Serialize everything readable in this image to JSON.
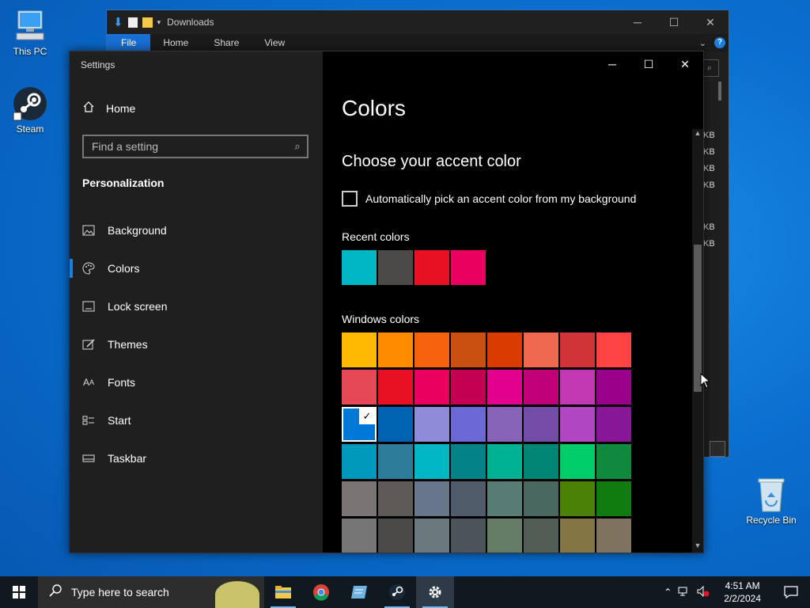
{
  "desktop": {
    "icons": [
      {
        "label": "This PC"
      },
      {
        "label": "Steam"
      },
      {
        "label": "Recycle Bin"
      }
    ]
  },
  "explorer": {
    "title": "Downloads",
    "ribbon_tabs": [
      "File",
      "Home",
      "Share",
      "View"
    ],
    "help": "?",
    "sizes": [
      "KB",
      "KB",
      "KB",
      "KB",
      "KB",
      "KB"
    ]
  },
  "settings": {
    "window_title": "Settings",
    "home_label": "Home",
    "search_placeholder": "Find a setting",
    "section": "Personalization",
    "nav": [
      {
        "label": "Background",
        "icon": "picture-icon"
      },
      {
        "label": "Colors",
        "icon": "palette-icon",
        "active": true
      },
      {
        "label": "Lock screen",
        "icon": "lock-screen-icon"
      },
      {
        "label": "Themes",
        "icon": "brush-icon"
      },
      {
        "label": "Fonts",
        "icon": "font-icon"
      },
      {
        "label": "Start",
        "icon": "start-icon"
      },
      {
        "label": "Taskbar",
        "icon": "taskbar-icon"
      }
    ],
    "page_title": "Colors",
    "accent_heading": "Choose your accent color",
    "auto_pick_label": "Automatically pick an accent color from my background",
    "auto_pick_checked": false,
    "recent_label": "Recent colors",
    "recent_colors": [
      "#00b7c3",
      "#4c4a48",
      "#e81123",
      "#ea005e"
    ],
    "windows_label": "Windows colors",
    "selected_color": "#0078d7",
    "windows_colors": [
      "#ffb900",
      "#ff8c00",
      "#f7630c",
      "#ca5010",
      "#da3b01",
      "#ef6950",
      "#d13438",
      "#ff4343",
      "#e74856",
      "#e81123",
      "#ea005e",
      "#c30052",
      "#e3008c",
      "#bf0077",
      "#c239b3",
      "#9a0089",
      "#0078d7",
      "#0063b1",
      "#8e8cd8",
      "#6b69d6",
      "#8764b8",
      "#744da9",
      "#b146c2",
      "#881798",
      "#0099bc",
      "#2d7d9a",
      "#00b7c3",
      "#038387",
      "#00b294",
      "#018574",
      "#00cc6a",
      "#10893e",
      "#7a7574",
      "#5d5a58",
      "#68768a",
      "#515c6b",
      "#567c73",
      "#486860",
      "#498205",
      "#107c10",
      "#767676",
      "#4c4a48",
      "#69797e",
      "#4a5459",
      "#647c64",
      "#525e54",
      "#847545",
      "#7e735f"
    ]
  },
  "taskbar": {
    "search_placeholder": "Type here to search",
    "time": "4:51 AM",
    "date": "2/2/2024"
  },
  "colors": {
    "accent": "#0078d7",
    "sidebar_bg": "#1f1f1f",
    "content_bg": "#000000"
  }
}
